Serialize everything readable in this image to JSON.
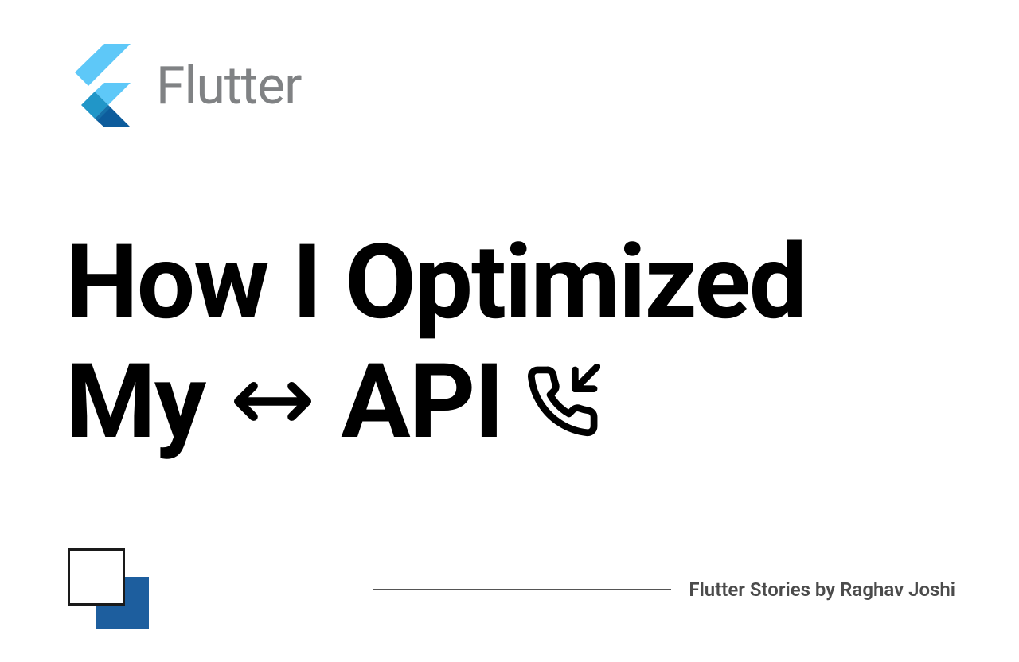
{
  "brand": {
    "name": "Flutter"
  },
  "title": {
    "line1": "How I Optimized",
    "word1": "My",
    "word2": "API"
  },
  "footer": {
    "byline": "Flutter Stories by Raghav Joshi"
  }
}
